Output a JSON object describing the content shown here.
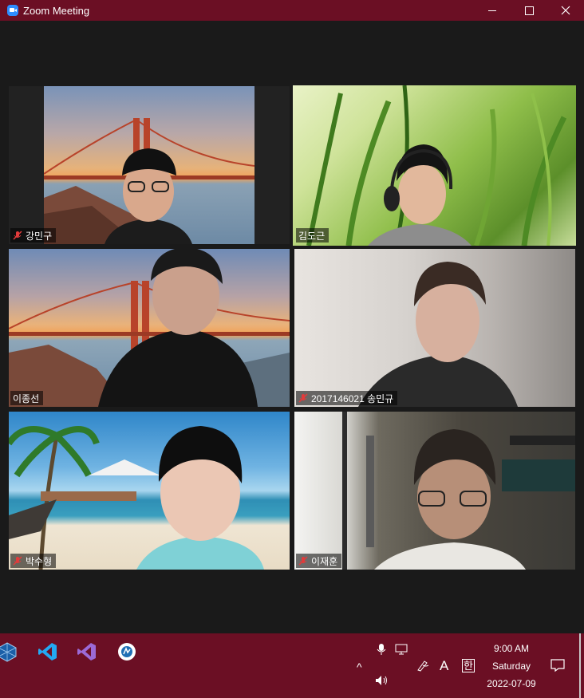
{
  "window": {
    "title": "Zoom Meeting"
  },
  "participants": [
    {
      "name": "강민구",
      "muted": true,
      "active": false
    },
    {
      "name": "김도근",
      "muted": false,
      "active": true
    },
    {
      "name": "이종선",
      "muted": false,
      "active": false
    },
    {
      "name": "2017146021 송민규",
      "muted": true,
      "active": false
    },
    {
      "name": "박수형",
      "muted": true,
      "active": false
    },
    {
      "name": "이재훈",
      "muted": true,
      "active": false
    }
  ],
  "taskbar": {
    "icons": [
      "virtualbox-icon",
      "vscode-icon",
      "visual-studio-icon",
      "app-icon"
    ],
    "tray": {
      "time": "9:00 AM",
      "day": "Saturday",
      "date": "2022-07-09",
      "ime_a": "A",
      "ime_han": "한",
      "chevron": "^"
    }
  },
  "colors": {
    "titlebar": "#6b0f24",
    "active_outline": "#c6e75a",
    "stage": "#1a1a1a"
  }
}
